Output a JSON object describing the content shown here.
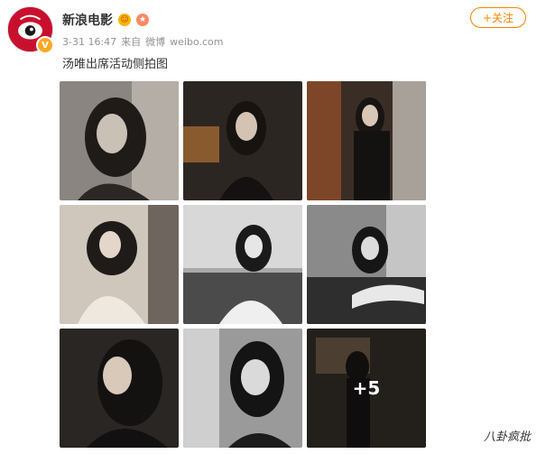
{
  "post": {
    "author": "新浪电影",
    "timestamp": "3-31 16:47",
    "source_prefix": "来自",
    "source_app": "微博",
    "source_site": "weibo.com",
    "text": "汤唯出席活动侧拍图",
    "follow_label": "+关注"
  },
  "gallery": {
    "more_count": "+5"
  },
  "watermark": "八卦疯批",
  "colors": {
    "accent": "#ff8200",
    "brand_red": "#c8102e",
    "meta_gray": "#939393"
  },
  "icons": {
    "verified": "verified-badge-icon",
    "avatar": "weibo-eye-logo"
  }
}
